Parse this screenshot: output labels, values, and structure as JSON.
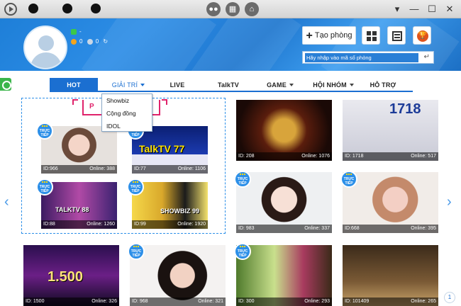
{
  "header": {
    "user_rank": "-",
    "coins": "0",
    "gems": "0",
    "create_room_label": "Tạo phòng",
    "room_search_placeholder": "Hãy nhập vào mã số phòng"
  },
  "nav": {
    "items": [
      {
        "label": "HOT",
        "dropdown": false,
        "active": true
      },
      {
        "label": "GIẢI TRÍ",
        "dropdown": true,
        "open": true
      },
      {
        "label": "LIVE",
        "dropdown": false
      },
      {
        "label": "TalkTV",
        "dropdown": false
      },
      {
        "label": "GAME",
        "dropdown": true
      },
      {
        "label": "HỘI NHÓM",
        "dropdown": true
      },
      {
        "label": "HỖ TRỢ",
        "dropdown": false
      }
    ],
    "dropdown_items": [
      "Showbiz",
      "Cộng đồng",
      "IDOL"
    ]
  },
  "featured": {
    "tab_label": "P"
  },
  "live_label": "TRỰC TIẾP",
  "rooms": [
    {
      "id": "ID:966",
      "online": "Online: 388",
      "caption": ""
    },
    {
      "id": "ID:77",
      "online": "Online: 1106",
      "caption": "TalkTV 77"
    },
    {
      "id": "ID:88",
      "online": "Online: 1260",
      "caption": "TALKTV 88"
    },
    {
      "id": "ID:99",
      "online": "Online: 1920",
      "caption": "SHOWBIZ 99"
    },
    {
      "id": "ID: 208",
      "online": "Online: 1076",
      "caption": ""
    },
    {
      "id": "ID: 1718",
      "online": "Online: 517",
      "caption": "1718"
    },
    {
      "id": "ID: 983",
      "online": "Online: 337",
      "caption": ""
    },
    {
      "id": "ID:668",
      "online": "Online: 395",
      "caption": ""
    },
    {
      "id": "ID: 1500",
      "online": "Online: 326",
      "caption": "1.500"
    },
    {
      "id": "ID: 968",
      "online": "Online: 321",
      "caption": ""
    },
    {
      "id": "ID: 300",
      "online": "Online: 293",
      "caption": ""
    },
    {
      "id": "ID: 101409",
      "online": "Online: 265",
      "caption": ""
    }
  ],
  "page_number": "1",
  "colors": {
    "accent": "#1b6fd1",
    "featured": "#e0236b",
    "header": "#2a84dc"
  }
}
